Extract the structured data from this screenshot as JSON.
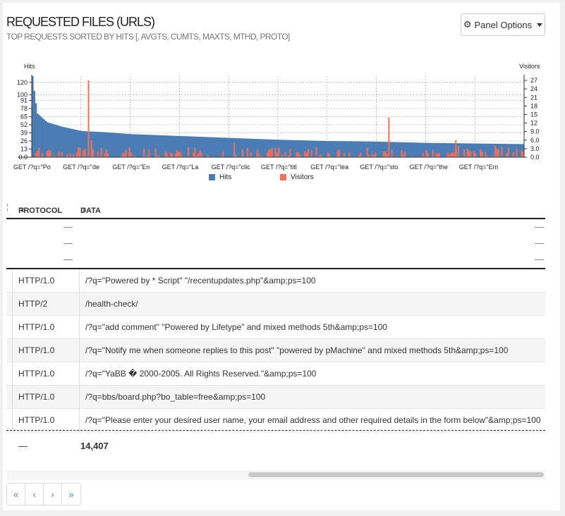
{
  "header": {
    "title": "REQUESTED FILES (URLS)",
    "subtitle": "TOP REQUESTS SORTED BY HITS [, AVGTS, CUMTS, MAXTS, MTHD, PROTO]",
    "panel_options_label": "Panel Options",
    "panel_options_icon": "gear-icon"
  },
  "chart_data": {
    "type": "bar",
    "left_axis_label": "Hits",
    "right_axis_label": "Visitors",
    "left_ticks": [
      "120",
      "100",
      "91",
      "78",
      "65",
      "52",
      "39",
      "26",
      "13",
      "0.0"
    ],
    "right_ticks": [
      "27",
      "24",
      "21",
      "18",
      "15",
      "12",
      "9.0",
      "6.0",
      "3.0",
      "0.0"
    ],
    "left_ylim": [
      0,
      130
    ],
    "right_ylim": [
      0,
      28.5
    ],
    "x_tick_labels": [
      "GET /?q=\"Po",
      "GET /?q=\"de",
      "GET /?q=\"En",
      "GET /?q=\"La",
      "GET /?q=\"clic",
      "GET /?q=\"titl",
      "GET /?q=\"lea",
      "GET /?q=\"sto",
      "GET /?q=\"the",
      "GET /?q=\"Em"
    ],
    "series": [
      {
        "name": "Hits",
        "color": "#4a7db5",
        "profile": [
          [
            0,
            130
          ],
          [
            0.005,
            95
          ],
          [
            0.01,
            70
          ],
          [
            0.03,
            56
          ],
          [
            0.06,
            49
          ],
          [
            0.1,
            42
          ],
          [
            0.15,
            40
          ],
          [
            0.2,
            37
          ],
          [
            0.3,
            34
          ],
          [
            0.4,
            31
          ],
          [
            0.5,
            28
          ],
          [
            0.6,
            26
          ],
          [
            0.7,
            25
          ],
          [
            0.8,
            23
          ],
          [
            0.9,
            22
          ],
          [
            1,
            21
          ]
        ]
      },
      {
        "name": "Visitors",
        "color": "#f4705a",
        "peaks": [
          [
            0.114,
            27
          ],
          [
            0.724,
            14
          ],
          [
            0.86,
            6
          ],
          [
            0.865,
            4
          ],
          [
            0.94,
            4
          ],
          [
            0.41,
            5
          ],
          [
            0.12,
            6
          ]
        ]
      }
    ],
    "legend": "bottom-center"
  },
  "table": {
    "columns": [
      "PROTOCOL",
      "DATA"
    ],
    "sort_icon": "sort-icon",
    "dash_rows": [
      "—",
      "—",
      "—"
    ],
    "rows": [
      {
        "protocol": "HTTP/1.0",
        "data": "/?q=\"Powered by * Script\" \"/recentupdates.php\"&amp;ps=100"
      },
      {
        "protocol": "HTTP/2",
        "data": "/health-check/"
      },
      {
        "protocol": "HTTP/1.0",
        "data": "/?q=\"add comment\" \"Powered by Lifetype\" and mixed methods 5th&amp;ps=100"
      },
      {
        "protocol": "HTTP/1.0",
        "data": "/?q=\"Notify me when someone replies to this post\" \"powered by pMachine\" and mixed methods 5th&amp;ps=100"
      },
      {
        "protocol": "HTTP/1.0",
        "data": "/?q=\"YaBB � 2000-2005. All Rights Reserved.\"&amp;ps=100"
      },
      {
        "protocol": "HTTP/1.0",
        "data": "/?q=bbs/board.php?bo_table=free&amp;ps=100"
      },
      {
        "protocol": "HTTP/1.0",
        "data": "/?q=\"Please enter your desired user name, your email address and other required details in the form below\"&amp;ps=100"
      }
    ],
    "totals": {
      "protocol": "—",
      "data": "14,407"
    }
  },
  "pager": {
    "first": "«",
    "prev": "‹",
    "next": "›",
    "last": "»"
  }
}
